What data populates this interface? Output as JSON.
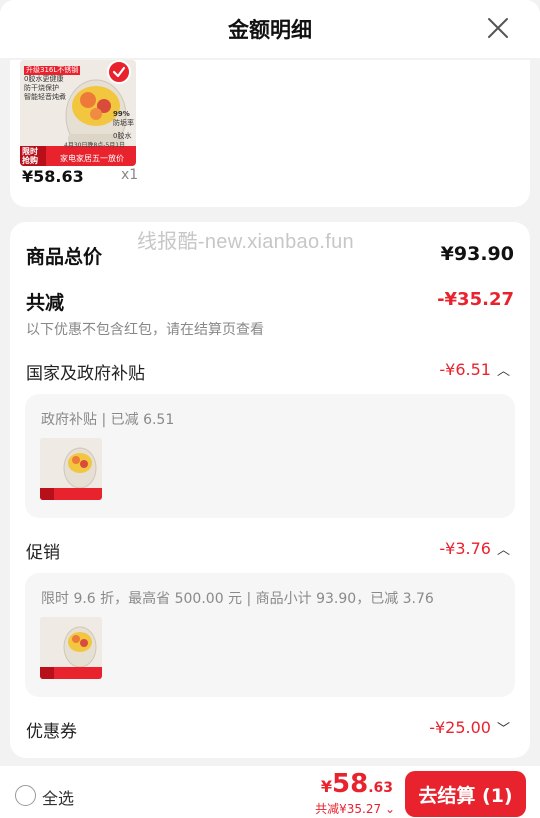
{
  "header": {
    "title": "金额明细",
    "close_icon": "close-icon"
  },
  "cart_item": {
    "price": "¥58.63",
    "quantity": "x1",
    "image": {
      "line1": "升级316L不锈钢",
      "line2": "0胶水更健康",
      "line3": "防干烧保护",
      "line4": "智能轻音炖煮",
      "pct": "99%",
      "pct_note": "防垢率",
      "side": "0胶水",
      "date": "4月30日晚8点-5月1日",
      "tag1": "限时",
      "tag2": "抢购",
      "banner": "家电家居五一放价"
    }
  },
  "watermark": "线报酷-new.xianbao.fun",
  "summary": {
    "total_label": "商品总价",
    "total_value": "¥93.90",
    "discount_label": "共减",
    "discount_value": "-¥35.27",
    "discount_note": "以下优惠不包含红包，请在结算页查看"
  },
  "subsidy": {
    "label": "国家及政府补贴",
    "value": "-¥6.51",
    "detail": "政府补贴 | 已减 6.51"
  },
  "promotion": {
    "label": "促销",
    "value": "-¥3.76",
    "detail": "限时 9.6 折，最高省 500.00 元 | 商品小计 93.90，已减 3.76"
  },
  "coupon": {
    "label": "优惠券",
    "value": "-¥25.00"
  },
  "footer": {
    "select_all": "全选",
    "currency": "¥",
    "price_int": "58",
    "price_dec": ".63",
    "saving": "共减¥35.27",
    "checkout": "去结算 (1)"
  },
  "colors": {
    "accent": "#e8232e",
    "background": "#f2f2f2"
  }
}
